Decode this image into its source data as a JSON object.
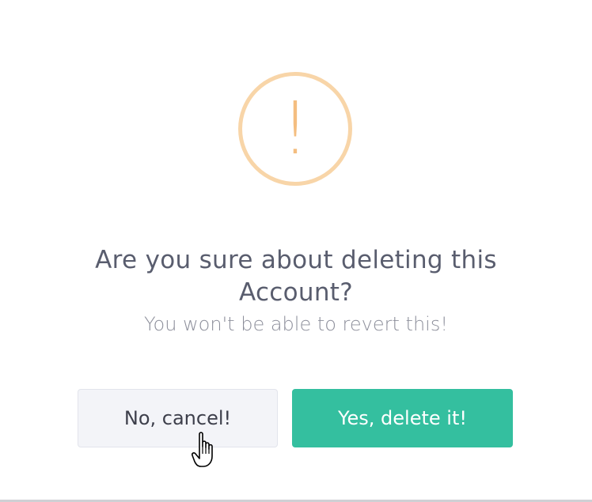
{
  "dialog": {
    "icon": "warning-icon",
    "icon_glyph": "!",
    "title": "Are you sure about deleting this Account?",
    "message": "You won't be able to revert this!",
    "cancel_label": "No, cancel!",
    "confirm_label": "Yes, delete it!"
  },
  "colors": {
    "icon_ring": "#f8d5a8",
    "icon_glyph": "#f4be80",
    "title": "#595d6e",
    "message": "#8d8f9b",
    "cancel_bg": "#f3f4f8",
    "confirm_bg": "#34bf9f",
    "confirm_text": "#ffffff"
  },
  "cursor": {
    "icon": "hand-pointer-icon"
  }
}
